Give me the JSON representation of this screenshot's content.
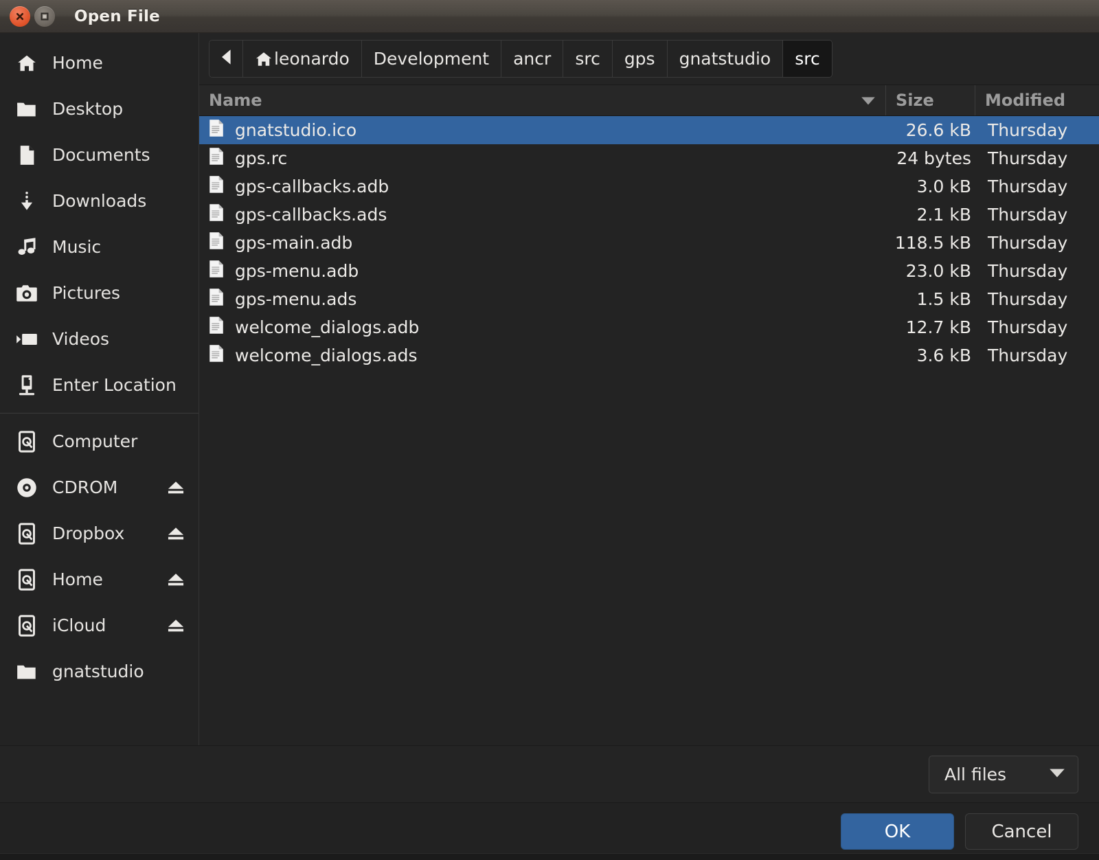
{
  "window": {
    "title": "Open File",
    "close_icon": "close-icon",
    "maximize_icon": "maximize-icon"
  },
  "colors": {
    "selection_blue": "#33649f",
    "primary_button": "#33649f",
    "list_background": "#232323",
    "sidebar_background": "#232323",
    "titlebar_top": "#5b554e",
    "close_button": "#e2552c",
    "text": "#eceae7",
    "header_text": "#9c9c9c"
  },
  "sidebar": {
    "items": [
      {
        "label": "Home",
        "icon": "home-icon",
        "eject": false
      },
      {
        "label": "Desktop",
        "icon": "folder-icon",
        "eject": false
      },
      {
        "label": "Documents",
        "icon": "document-icon",
        "eject": false
      },
      {
        "label": "Downloads",
        "icon": "download-icon",
        "eject": false
      },
      {
        "label": "Music",
        "icon": "music-note-icon",
        "eject": false
      },
      {
        "label": "Pictures",
        "icon": "camera-icon",
        "eject": false
      },
      {
        "label": "Videos",
        "icon": "video-camera-icon",
        "eject": false
      },
      {
        "label": "Enter Location",
        "icon": "enter-location-icon",
        "eject": false
      }
    ],
    "items_after_separator": [
      {
        "label": "Computer",
        "icon": "drive-icon",
        "eject": false
      },
      {
        "label": "CDROM",
        "icon": "disc-icon",
        "eject": true
      },
      {
        "label": "Dropbox",
        "icon": "drive-icon",
        "eject": true
      },
      {
        "label": "Home",
        "icon": "drive-icon",
        "eject": true
      },
      {
        "label": "iCloud",
        "icon": "drive-icon",
        "eject": true
      },
      {
        "label": "gnatstudio",
        "icon": "folder-icon",
        "eject": false
      }
    ]
  },
  "pathbar": {
    "back_icon": "back-arrow-icon",
    "home_icon": "home-icon",
    "crumbs": [
      {
        "label": "leonardo",
        "home": true,
        "active": false
      },
      {
        "label": "Development",
        "home": false,
        "active": false
      },
      {
        "label": "ancr",
        "home": false,
        "active": false
      },
      {
        "label": "src",
        "home": false,
        "active": false
      },
      {
        "label": "gps",
        "home": false,
        "active": false
      },
      {
        "label": "gnatstudio",
        "home": false,
        "active": false
      },
      {
        "label": "src",
        "home": false,
        "active": true
      }
    ]
  },
  "filelist": {
    "columns": {
      "name": "Name",
      "size": "Size",
      "modified": "Modified"
    },
    "sort_icon": "sort-descending-icon",
    "rows": [
      {
        "name": "gnatstudio.ico",
        "size": "26.6 kB",
        "modified": "Thursday",
        "selected": true,
        "icon": "file-icon"
      },
      {
        "name": "gps.rc",
        "size": "24 bytes",
        "modified": "Thursday",
        "selected": false,
        "icon": "file-icon"
      },
      {
        "name": "gps-callbacks.adb",
        "size": "3.0 kB",
        "modified": "Thursday",
        "selected": false,
        "icon": "file-icon"
      },
      {
        "name": "gps-callbacks.ads",
        "size": "2.1 kB",
        "modified": "Thursday",
        "selected": false,
        "icon": "file-icon"
      },
      {
        "name": "gps-main.adb",
        "size": "118.5 kB",
        "modified": "Thursday",
        "selected": false,
        "icon": "file-icon"
      },
      {
        "name": "gps-menu.adb",
        "size": "23.0 kB",
        "modified": "Thursday",
        "selected": false,
        "icon": "file-icon"
      },
      {
        "name": "gps-menu.ads",
        "size": "1.5 kB",
        "modified": "Thursday",
        "selected": false,
        "icon": "file-icon"
      },
      {
        "name": "welcome_dialogs.adb",
        "size": "12.7 kB",
        "modified": "Thursday",
        "selected": false,
        "icon": "file-icon"
      },
      {
        "name": "welcome_dialogs.ads",
        "size": "3.6 kB",
        "modified": "Thursday",
        "selected": false,
        "icon": "file-icon"
      }
    ]
  },
  "filter": {
    "selected": "All files",
    "chevron_icon": "chevron-down-icon"
  },
  "actions": {
    "ok_label": "OK",
    "cancel_label": "Cancel"
  }
}
